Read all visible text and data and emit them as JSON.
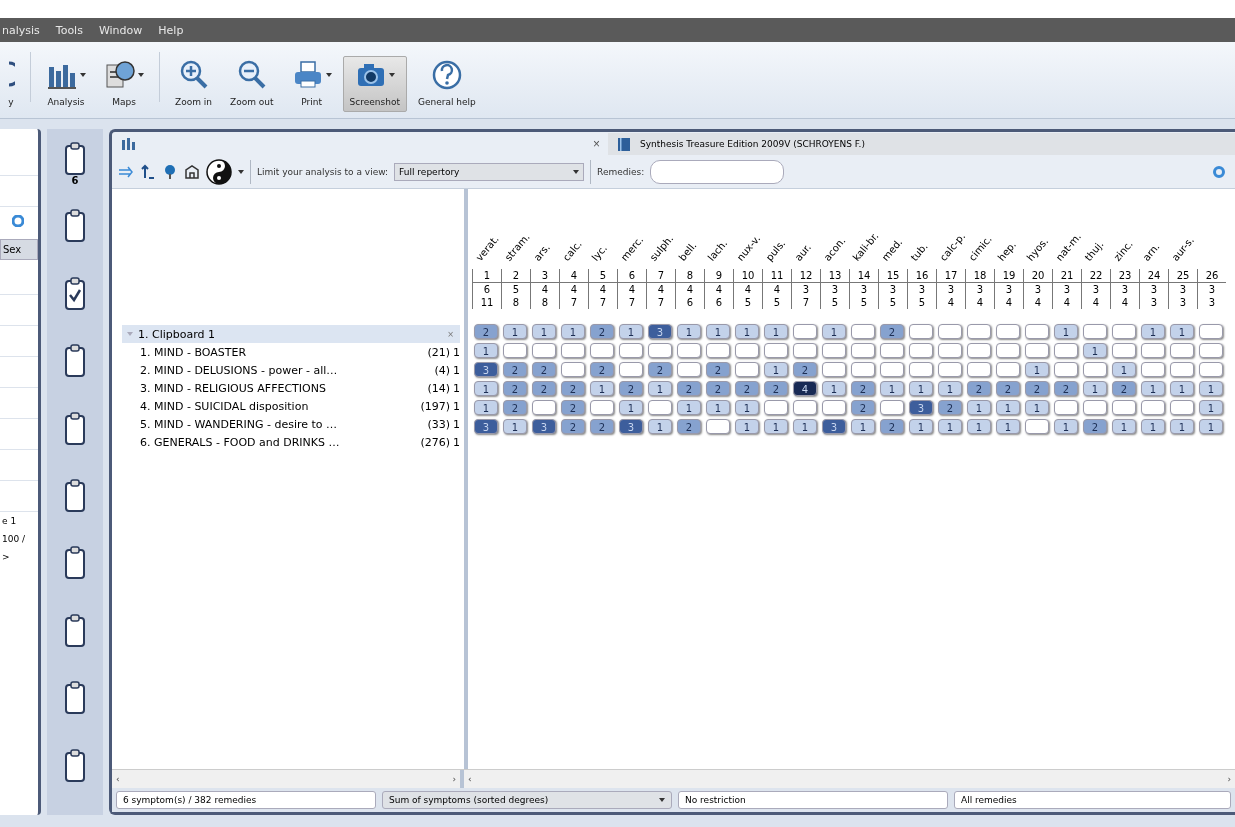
{
  "menu": [
    "nalysis",
    "Tools",
    "Window",
    "Help"
  ],
  "toolbar": [
    {
      "kind": "partial",
      "label": "y",
      "selected": false
    },
    {
      "kind": "analysis",
      "label": "Analysis",
      "selected": false,
      "caret": true
    },
    {
      "kind": "maps",
      "label": "Maps",
      "selected": false,
      "caret": true
    },
    {
      "kind": "zoomin",
      "label": "Zoom in",
      "selected": false
    },
    {
      "kind": "zoomout",
      "label": "Zoom out",
      "selected": false
    },
    {
      "kind": "print",
      "label": "Print",
      "selected": false,
      "caret": true
    },
    {
      "kind": "camera",
      "label": "Screenshot",
      "selected": true,
      "caret": true
    },
    {
      "kind": "help",
      "label": "General help",
      "selected": false
    }
  ],
  "left_panel": {
    "tab": "Sex",
    "lines": [
      "e 1",
      "100 /",
      ">"
    ]
  },
  "clipboards": [
    {
      "checked": false,
      "count": "6"
    },
    {
      "checked": false
    },
    {
      "checked": true
    },
    {
      "checked": false
    },
    {
      "checked": false
    },
    {
      "checked": false
    },
    {
      "checked": false
    },
    {
      "checked": false
    },
    {
      "checked": false
    },
    {
      "checked": false
    }
  ],
  "window": {
    "close": "×",
    "tab": "Synthesis Treasure Edition 2009V (SCHROYENS F.)"
  },
  "analysis_toolbar": {
    "view_label": "Limit your analysis to a view:",
    "view": "Full repertory",
    "remedies_label": "Remedies:"
  },
  "remedies": [
    {
      "name": "verat.",
      "index": "1",
      "symptoms": "6",
      "sum": "11"
    },
    {
      "name": "stram.",
      "index": "2",
      "symptoms": "5",
      "sum": "8"
    },
    {
      "name": "ars.",
      "index": "3",
      "symptoms": "4",
      "sum": "8"
    },
    {
      "name": "calc.",
      "index": "4",
      "symptoms": "4",
      "sum": "7"
    },
    {
      "name": "lyc.",
      "index": "5",
      "symptoms": "4",
      "sum": "7"
    },
    {
      "name": "merc.",
      "index": "6",
      "symptoms": "4",
      "sum": "7"
    },
    {
      "name": "sulph.",
      "index": "7",
      "symptoms": "4",
      "sum": "7"
    },
    {
      "name": "bell.",
      "index": "8",
      "symptoms": "4",
      "sum": "6"
    },
    {
      "name": "lach.",
      "index": "9",
      "symptoms": "4",
      "sum": "6"
    },
    {
      "name": "nux-v.",
      "index": "10",
      "symptoms": "4",
      "sum": "5"
    },
    {
      "name": "puls.",
      "index": "11",
      "symptoms": "4",
      "sum": "5"
    },
    {
      "name": "aur.",
      "index": "12",
      "symptoms": "3",
      "sum": "7"
    },
    {
      "name": "acon.",
      "index": "13",
      "symptoms": "3",
      "sum": "5"
    },
    {
      "name": "kali-br.",
      "index": "14",
      "symptoms": "3",
      "sum": "5"
    },
    {
      "name": "med.",
      "index": "15",
      "symptoms": "3",
      "sum": "5"
    },
    {
      "name": "tub.",
      "index": "16",
      "symptoms": "3",
      "sum": "5"
    },
    {
      "name": "calc-p.",
      "index": "17",
      "symptoms": "3",
      "sum": "4"
    },
    {
      "name": "cimic.",
      "index": "18",
      "symptoms": "3",
      "sum": "4"
    },
    {
      "name": "hep.",
      "index": "19",
      "symptoms": "3",
      "sum": "4"
    },
    {
      "name": "hyos.",
      "index": "20",
      "symptoms": "3",
      "sum": "4"
    },
    {
      "name": "nat-m.",
      "index": "21",
      "symptoms": "3",
      "sum": "4"
    },
    {
      "name": "thuj.",
      "index": "22",
      "symptoms": "3",
      "sum": "4"
    },
    {
      "name": "zinc.",
      "index": "23",
      "symptoms": "3",
      "sum": "4"
    },
    {
      "name": "arn.",
      "index": "24",
      "symptoms": "3",
      "sum": "3"
    },
    {
      "name": "aur-s.",
      "index": "25",
      "symptoms": "3",
      "sum": "3"
    },
    {
      "index": "26",
      "symptoms": "3",
      "sum": "3"
    }
  ],
  "clipboard": {
    "label": "1. Clipboard 1",
    "close": "×",
    "expanded": true
  },
  "symptoms": [
    {
      "label": "1. MIND - BOASTER",
      "count": "(21)",
      "weight": "1",
      "grades": [
        {
          "kind": "grade",
          "text": "2",
          "color": "#86a2cf"
        },
        {
          "kind": "grade",
          "text": "1",
          "color": "#c3d2ea"
        },
        {
          "kind": "grade",
          "text": "1",
          "color": "#c3d2ea"
        },
        {
          "kind": "grade",
          "text": "1",
          "color": "#c3d2ea"
        },
        {
          "kind": "grade",
          "text": "2",
          "color": "#86a2cf"
        },
        {
          "kind": "grade",
          "text": "1",
          "color": "#c3d2ea"
        },
        {
          "kind": "grade",
          "text": "3",
          "color": "#3d5e9c"
        },
        {
          "kind": "grade",
          "text": "1",
          "color": "#c3d2ea"
        },
        {
          "kind": "grade",
          "text": "1",
          "color": "#c3d2ea"
        },
        {
          "kind": "grade",
          "text": "1",
          "color": "#c3d2ea"
        },
        {
          "kind": "grade",
          "text": "1",
          "color": "#c3d2ea"
        },
        {
          "kind": "empty"
        },
        {
          "kind": "grade",
          "text": "1",
          "color": "#c3d2ea"
        },
        {
          "kind": "empty"
        },
        {
          "kind": "grade",
          "text": "2",
          "color": "#86a2cf"
        },
        {
          "kind": "empty"
        },
        {
          "kind": "empty"
        },
        {
          "kind": "empty"
        },
        {
          "kind": "empty"
        },
        {
          "kind": "empty"
        },
        {
          "kind": "grade",
          "text": "1",
          "color": "#c3d2ea"
        },
        {
          "kind": "empty"
        },
        {
          "kind": "empty"
        },
        {
          "kind": "grade",
          "text": "1",
          "color": "#c3d2ea"
        },
        {
          "kind": "grade",
          "text": "1",
          "color": "#c3d2ea"
        },
        {
          "kind": "empty"
        }
      ]
    },
    {
      "label": "2. MIND - DELUSIONS - power - all…",
      "count": "(4)",
      "weight": "1",
      "grades": [
        {
          "kind": "grade",
          "text": "1",
          "color": "#c3d2ea"
        },
        {
          "kind": "empty"
        },
        {
          "kind": "empty"
        },
        {
          "kind": "empty"
        },
        {
          "kind": "empty"
        },
        {
          "kind": "empty"
        },
        {
          "kind": "empty"
        },
        {
          "kind": "empty"
        },
        {
          "kind": "empty"
        },
        {
          "kind": "empty"
        },
        {
          "kind": "empty"
        },
        {
          "kind": "empty"
        },
        {
          "kind": "empty"
        },
        {
          "kind": "empty"
        },
        {
          "kind": "empty"
        },
        {
          "kind": "empty"
        },
        {
          "kind": "empty"
        },
        {
          "kind": "empty"
        },
        {
          "kind": "empty"
        },
        {
          "kind": "empty"
        },
        {
          "kind": "empty"
        },
        {
          "kind": "grade",
          "text": "1",
          "color": "#c3d2ea"
        },
        {
          "kind": "empty"
        },
        {
          "kind": "empty"
        },
        {
          "kind": "empty"
        },
        {
          "kind": "empty"
        }
      ]
    },
    {
      "label": "3. MIND - RELIGIOUS AFFECTIONS",
      "count": "(14)",
      "weight": "1",
      "grades": [
        {
          "kind": "grade",
          "text": "3",
          "color": "#3d5e9c"
        },
        {
          "kind": "grade",
          "text": "2",
          "color": "#86a2cf"
        },
        {
          "kind": "grade",
          "text": "2",
          "color": "#86a2cf"
        },
        {
          "kind": "empty"
        },
        {
          "kind": "grade",
          "text": "2",
          "color": "#86a2cf"
        },
        {
          "kind": "empty"
        },
        {
          "kind": "grade",
          "text": "2",
          "color": "#86a2cf"
        },
        {
          "kind": "empty"
        },
        {
          "kind": "grade",
          "text": "2",
          "color": "#86a2cf"
        },
        {
          "kind": "empty"
        },
        {
          "kind": "grade",
          "text": "1",
          "color": "#c3d2ea"
        },
        {
          "kind": "grade",
          "text": "2",
          "color": "#86a2cf"
        },
        {
          "kind": "empty"
        },
        {
          "kind": "empty"
        },
        {
          "kind": "empty"
        },
        {
          "kind": "empty"
        },
        {
          "kind": "empty"
        },
        {
          "kind": "empty"
        },
        {
          "kind": "empty"
        },
        {
          "kind": "grade",
          "text": "1",
          "color": "#c3d2ea"
        },
        {
          "kind": "empty"
        },
        {
          "kind": "empty"
        },
        {
          "kind": "grade",
          "text": "1",
          "color": "#c3d2ea"
        },
        {
          "kind": "empty"
        },
        {
          "kind": "empty"
        },
        {
          "kind": "empty"
        }
      ]
    },
    {
      "label": "4. MIND - SUICIDAL disposition",
      "count": "(197)",
      "weight": "1",
      "grades": [
        {
          "kind": "grade",
          "text": "1",
          "color": "#c3d2ea"
        },
        {
          "kind": "grade",
          "text": "2",
          "color": "#86a2cf"
        },
        {
          "kind": "grade",
          "text": "2",
          "color": "#86a2cf"
        },
        {
          "kind": "grade",
          "text": "2",
          "color": "#86a2cf"
        },
        {
          "kind": "grade",
          "text": "1",
          "color": "#c3d2ea"
        },
        {
          "kind": "grade",
          "text": "2",
          "color": "#86a2cf"
        },
        {
          "kind": "grade",
          "text": "1",
          "color": "#c3d2ea"
        },
        {
          "kind": "grade",
          "text": "2",
          "color": "#86a2cf"
        },
        {
          "kind": "grade",
          "text": "2",
          "color": "#86a2cf"
        },
        {
          "kind": "grade",
          "text": "2",
          "color": "#86a2cf"
        },
        {
          "kind": "grade",
          "text": "2",
          "color": "#86a2cf"
        },
        {
          "kind": "grade",
          "text": "4",
          "color": "#182a55"
        },
        {
          "kind": "grade",
          "text": "1",
          "color": "#c3d2ea"
        },
        {
          "kind": "grade",
          "text": "2",
          "color": "#86a2cf"
        },
        {
          "kind": "grade",
          "text": "1",
          "color": "#c3d2ea"
        },
        {
          "kind": "grade",
          "text": "1",
          "color": "#c3d2ea"
        },
        {
          "kind": "grade",
          "text": "1",
          "color": "#c3d2ea"
        },
        {
          "kind": "grade",
          "text": "2",
          "color": "#86a2cf"
        },
        {
          "kind": "grade",
          "text": "2",
          "color": "#86a2cf"
        },
        {
          "kind": "grade",
          "text": "2",
          "color": "#86a2cf"
        },
        {
          "kind": "grade",
          "text": "2",
          "color": "#86a2cf"
        },
        {
          "kind": "grade",
          "text": "1",
          "color": "#c3d2ea"
        },
        {
          "kind": "grade",
          "text": "2",
          "color": "#86a2cf"
        },
        {
          "kind": "grade",
          "text": "1",
          "color": "#c3d2ea"
        },
        {
          "kind": "grade",
          "text": "1",
          "color": "#c3d2ea"
        },
        {
          "kind": "grade",
          "text": "1",
          "color": "#c3d2ea"
        }
      ]
    },
    {
      "label": "5. MIND - WANDERING - desire to …",
      "count": "(33)",
      "weight": "1",
      "grades": [
        {
          "kind": "grade",
          "text": "1",
          "color": "#c3d2ea"
        },
        {
          "kind": "grade",
          "text": "2",
          "color": "#86a2cf"
        },
        {
          "kind": "empty"
        },
        {
          "kind": "grade",
          "text": "2",
          "color": "#86a2cf"
        },
        {
          "kind": "empty"
        },
        {
          "kind": "grade",
          "text": "1",
          "color": "#c3d2ea"
        },
        {
          "kind": "empty"
        },
        {
          "kind": "grade",
          "text": "1",
          "color": "#c3d2ea"
        },
        {
          "kind": "grade",
          "text": "1",
          "color": "#c3d2ea"
        },
        {
          "kind": "grade",
          "text": "1",
          "color": "#c3d2ea"
        },
        {
          "kind": "empty"
        },
        {
          "kind": "empty"
        },
        {
          "kind": "empty"
        },
        {
          "kind": "grade",
          "text": "2",
          "color": "#86a2cf"
        },
        {
          "kind": "empty"
        },
        {
          "kind": "grade",
          "text": "3",
          "color": "#3d5e9c"
        },
        {
          "kind": "grade",
          "text": "2",
          "color": "#86a2cf"
        },
        {
          "kind": "grade",
          "text": "1",
          "color": "#c3d2ea"
        },
        {
          "kind": "grade",
          "text": "1",
          "color": "#c3d2ea"
        },
        {
          "kind": "grade",
          "text": "1",
          "color": "#c3d2ea"
        },
        {
          "kind": "empty"
        },
        {
          "kind": "empty"
        },
        {
          "kind": "empty"
        },
        {
          "kind": "empty"
        },
        {
          "kind": "empty"
        },
        {
          "kind": "grade",
          "text": "1",
          "color": "#c3d2ea"
        }
      ]
    },
    {
      "label": "6. GENERALS - FOOD and DRINKS …",
      "count": "(276)",
      "weight": "1",
      "grades": [
        {
          "kind": "grade",
          "text": "3",
          "color": "#3d5e9c"
        },
        {
          "kind": "grade",
          "text": "1",
          "color": "#c3d2ea"
        },
        {
          "kind": "grade",
          "text": "3",
          "color": "#3d5e9c"
        },
        {
          "kind": "grade",
          "text": "2",
          "color": "#86a2cf"
        },
        {
          "kind": "grade",
          "text": "2",
          "color": "#86a2cf"
        },
        {
          "kind": "grade",
          "text": "3",
          "color": "#3d5e9c"
        },
        {
          "kind": "grade",
          "text": "1",
          "color": "#c3d2ea"
        },
        {
          "kind": "grade",
          "text": "2",
          "color": "#86a2cf"
        },
        {
          "kind": "empty"
        },
        {
          "kind": "grade",
          "text": "1",
          "color": "#c3d2ea"
        },
        {
          "kind": "grade",
          "text": "1",
          "color": "#c3d2ea"
        },
        {
          "kind": "grade",
          "text": "1",
          "color": "#c3d2ea"
        },
        {
          "kind": "grade",
          "text": "3",
          "color": "#3d5e9c"
        },
        {
          "kind": "grade",
          "text": "1",
          "color": "#c3d2ea"
        },
        {
          "kind": "grade",
          "text": "2",
          "color": "#86a2cf"
        },
        {
          "kind": "grade",
          "text": "1",
          "color": "#c3d2ea"
        },
        {
          "kind": "grade",
          "text": "1",
          "color": "#c3d2ea"
        },
        {
          "kind": "grade",
          "text": "1",
          "color": "#c3d2ea"
        },
        {
          "kind": "grade",
          "text": "1",
          "color": "#c3d2ea"
        },
        {
          "kind": "empty"
        },
        {
          "kind": "grade",
          "text": "1",
          "color": "#c3d2ea"
        },
        {
          "kind": "grade",
          "text": "2",
          "color": "#86a2cf"
        },
        {
          "kind": "grade",
          "text": "1",
          "color": "#c3d2ea"
        },
        {
          "kind": "grade",
          "text": "1",
          "color": "#c3d2ea"
        },
        {
          "kind": "grade",
          "text": "1",
          "color": "#c3d2ea"
        },
        {
          "kind": "grade",
          "text": "1",
          "color": "#c3d2ea"
        }
      ]
    }
  ],
  "scrollbars": [
    {
      "left": "‹",
      "right": "›"
    },
    {
      "left": "‹",
      "right": "›"
    }
  ],
  "status_bar": {
    "summary": "6 symptom(s) / 382 remedies",
    "sort": "Sum of symptoms (sorted degrees)",
    "restriction": "No restriction",
    "filter": "All remedies"
  }
}
